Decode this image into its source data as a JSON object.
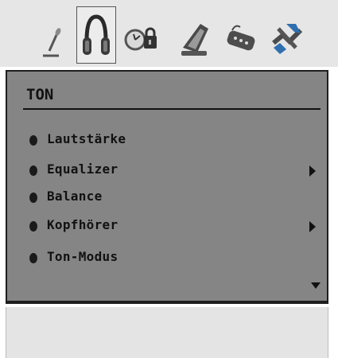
{
  "toolbar": {
    "tabs": [
      {
        "icon": "microphone-icon",
        "selected": false
      },
      {
        "icon": "headphones-icon",
        "selected": true
      },
      {
        "icon": "clock-lock-icon",
        "selected": false
      },
      {
        "icon": "satellite-dish-icon",
        "selected": false
      },
      {
        "icon": "remote-control-icon",
        "selected": false
      },
      {
        "icon": "tools-icon",
        "selected": false
      }
    ]
  },
  "menu": {
    "title": "TON",
    "items": [
      {
        "label": "Lautstärke",
        "submenu": false
      },
      {
        "label": "Equalizer",
        "submenu": true
      },
      {
        "label": "Balance",
        "submenu": false
      },
      {
        "label": "Kopfhörer",
        "submenu": true
      },
      {
        "label": "Ton-Modus",
        "submenu": false
      }
    ],
    "has_more": true
  },
  "colors": {
    "panel": "#858585",
    "text": "#111111",
    "accent_blue": "#2f6fb0"
  }
}
